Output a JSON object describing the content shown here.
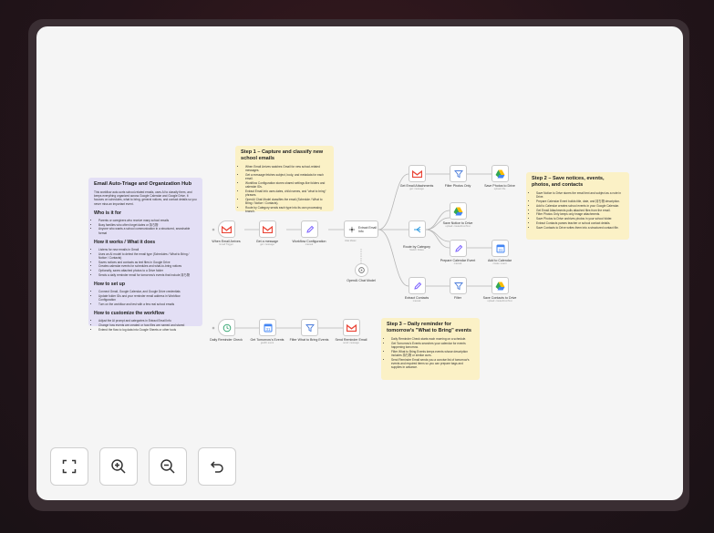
{
  "note_intro": {
    "title": "Email Auto-Triage and Organization Hub",
    "intro": "This workflow auto-sorts school-related emails, uses AI to classify them, and keeps everything organized across Google Calendar and Google Drive. It focuses on schedules, what to bring, general notices, and contact details so you never miss an important event.",
    "who_title": "Who is it for",
    "who": [
      "Parents or caregivers who receive many school emails",
      "Busy families who often forget dates or 持ち物",
      "Anyone who wants a school communication in a structured, searchable format"
    ],
    "how_title": "How it works / What it does",
    "how": [
      "Listens for new emails in Gmail",
      "Uses an AI model to detect the email type (Schedules / What to Bring / Notice / Contacts)",
      "Saves notices and contacts as text files in Google Drive",
      "Creates calendar events for schedules and what-to-bring notices",
      "Optionally, saves attached photos to a Drive folder",
      "Sends a daily reminder email for tomorrow's events that include 持ち物"
    ],
    "setup_title": "How to set up",
    "setup": [
      "Connect Gmail, Google Calendar, and Google Drive credentials",
      "Update folder IDs and your reminder email address in Workflow Configuration",
      "Turn on the workflow and test with a few real school emails"
    ],
    "custom_title": "How to customize the workflow",
    "custom": [
      "Adjust the AI prompt and categories in Extract Email Info",
      "Change how events are created or how files are named and stored",
      "Extend the flow to log data into Google Sheets or other tools"
    ]
  },
  "note_step1": {
    "title": "Step 1 – Capture and classify new school emails",
    "items": [
      "When Email Arrives watches Gmail for new school-related messages.",
      "Get a message fetches subject, body, and metadata for each email.",
      "Workflow Configuration stores shared settings like folders and calendar IDs.",
      "Extract Email Info uses dates, child names, and \"what to bring\" phrases.",
      "OpenAI Chat Model classifies the email (Schedule / What to Bring / Notice / Contacts).",
      "Route by Category sends each type into its own processing branch."
    ]
  },
  "note_step2": {
    "title": "Step 2 – Save notices, events, photos, and contacts",
    "items": [
      "Save Notice to Drive stores the email text and subject as a note in Drive.",
      "Prepare Calendar Event builds title, date, and 持ち物 description.",
      "Add to Calendar creates school events in your Google Calendar.",
      "Get Email Attachments pulls attached files from the email.",
      "Filter Photos Only keeps only image attachments.",
      "Save Photos to Drive archives photos in your school folder.",
      "Extract Contacts parses teacher or school contact details.",
      "Save Contacts to Drive writes them into a structured contact file."
    ]
  },
  "note_step3": {
    "title": "Step 3 – Daily reminder for tomorrow's \"What to Bring\" events",
    "items": [
      "Daily Reminder Check starts each morning on a schedule.",
      "Get Tomorrow's Events searches your calendar for events happening tomorrow.",
      "Filter What to Bring Events keeps events whose description includes 持ち物 or similar cues.",
      "Send Reminder Email sends you a concise list of tomorrow's events and required items so you can prepare bags and supplies in advance."
    ]
  },
  "nodes": {
    "when_email": {
      "label": "When Email Arrives",
      "sub": "Gmail Trigger"
    },
    "get_message": {
      "label": "Get a message",
      "sub": "get: message"
    },
    "workflow_config": {
      "label": "Workflow Configuration",
      "sub": "manual"
    },
    "extract_info": {
      "label": "Extract Email Info",
      "sub": ""
    },
    "openai": {
      "label": "OpenAI Chat Model",
      "sub": ""
    },
    "route": {
      "label": "Route by Category",
      "sub": "Switch: Rules"
    },
    "get_attach": {
      "label": "Get Email Attachments",
      "sub": "get: message"
    },
    "filter_photos": {
      "label": "Filter Photos Only",
      "sub": ""
    },
    "save_photos": {
      "label": "Save Photos to Drive",
      "sub": "upload: file"
    },
    "save_notice": {
      "label": "Save Notice to Drive",
      "sub": "upload: createFromText"
    },
    "prep_event": {
      "label": "Prepare Calendar Event",
      "sub": "manual"
    },
    "add_cal": {
      "label": "Add to Calendar",
      "sub": "create: event"
    },
    "extract_contacts": {
      "label": "Extract Contacts",
      "sub": "manual"
    },
    "filter": {
      "label": "Filter",
      "sub": ""
    },
    "save_contacts": {
      "label": "Save Contacts to Drive",
      "sub": "upload: createFromText"
    },
    "daily_check": {
      "label": "Daily Reminder Check",
      "sub": ""
    },
    "get_tomorrow": {
      "label": "Get Tomorrow's Events",
      "sub": "getAll: event"
    },
    "filter_bring": {
      "label": "Filter What to Bring Events",
      "sub": ""
    },
    "send_reminder": {
      "label": "Send Reminder Email",
      "sub": "send: message"
    }
  },
  "tool_tags": {
    "chat_model": "Chat Model",
    "model": "Model"
  },
  "controls": {
    "fit": "fit-view-icon",
    "zoom_in": "zoom-in-icon",
    "zoom_out": "zoom-out-icon",
    "undo": "undo-icon"
  },
  "colors": {
    "gmail_red": "#ea4335",
    "filter_blue": "#4a7cdb",
    "config_purple": "#7b61ff",
    "schedule_green": "#3aa876"
  }
}
